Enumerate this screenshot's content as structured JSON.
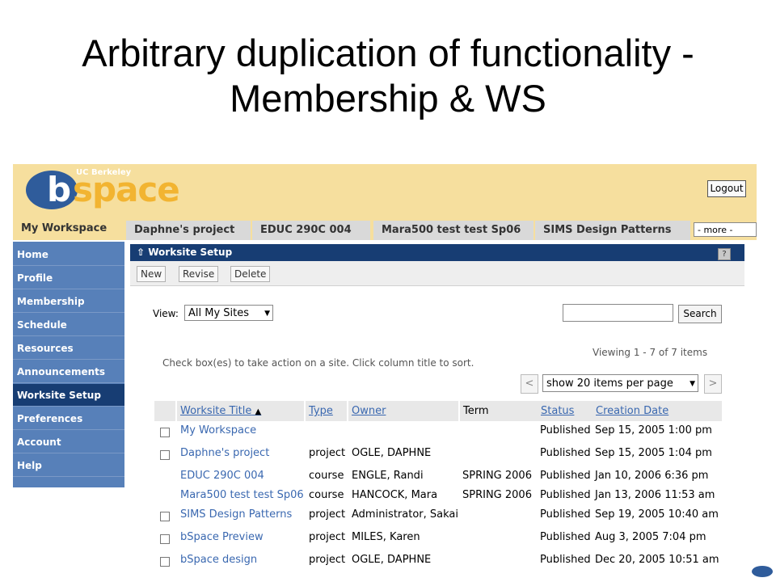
{
  "slide": {
    "title_line1": "Arbitrary duplication of functionality -",
    "title_line2": "Membership & WS"
  },
  "header": {
    "logo_small": "UC Berkeley",
    "logo_b": "b",
    "logo_space": "space",
    "logout": "Logout"
  },
  "tabs": [
    "My Workspace",
    "Daphne's project",
    "EDUC 290C 004",
    "Mara500 test test Sp06",
    "SIMS Design Patterns"
  ],
  "more_select": "- more -",
  "sidebar": {
    "items": [
      "Home",
      "Profile",
      "Membership",
      "Schedule",
      "Resources",
      "Announcements",
      "Worksite Setup",
      "Preferences",
      "Account",
      "Help"
    ],
    "active": "Worksite Setup"
  },
  "tool": {
    "title": "Worksite Setup",
    "help": "?"
  },
  "toolbar": {
    "new": "New",
    "revise": "Revise",
    "delete": "Delete"
  },
  "filter": {
    "view_label": "View:",
    "view_value": "All My Sites",
    "search_button": "Search"
  },
  "instructions": "Check box(es) to take action on a site. Click column title to sort.",
  "pager": {
    "viewing": "Viewing 1 - 7 of 7 items",
    "prev": "<",
    "next": ">",
    "page_size": "show 20 items per page"
  },
  "table": {
    "headers": [
      "Worksite Title",
      "Type",
      "Owner",
      "Term",
      "Status",
      "Creation Date"
    ],
    "rows": [
      {
        "title": "My Workspace",
        "type": "",
        "owner": "",
        "term": "",
        "status": "Published",
        "date": "Sep 15, 2005 1:00 pm"
      },
      {
        "title": "Daphne's project",
        "type": "project",
        "owner": "OGLE, DAPHNE",
        "term": "",
        "status": "Published",
        "date": "Sep 15, 2005 1:04 pm"
      },
      {
        "title": "EDUC 290C 004",
        "type": "course",
        "owner": "ENGLE, Randi",
        "term": "SPRING 2006",
        "status": "Published",
        "date": "Jan 10, 2006 6:36 pm"
      },
      {
        "title": "Mara500 test test Sp06",
        "type": "course",
        "owner": "HANCOCK, Mara",
        "term": "SPRING 2006",
        "status": "Published",
        "date": "Jan 13, 2006 11:53 am"
      },
      {
        "title": "SIMS Design Patterns",
        "type": "project",
        "owner": "Administrator, Sakai",
        "term": "",
        "status": "Published",
        "date": "Sep 19, 2005 10:40 am"
      },
      {
        "title": "bSpace Preview",
        "type": "project",
        "owner": "MILES, Karen",
        "term": "",
        "status": "Published",
        "date": "Aug 3, 2005 7:04 pm"
      },
      {
        "title": "bSpace design",
        "type": "project",
        "owner": "OGLE, DAPHNE",
        "term": "",
        "status": "Published",
        "date": "Dec 20, 2005 10:51 am"
      }
    ]
  }
}
